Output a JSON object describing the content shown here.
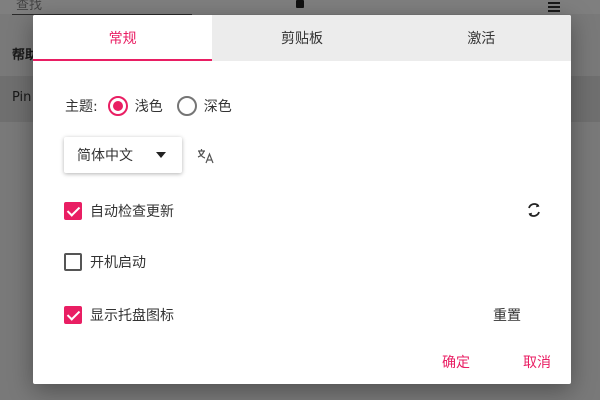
{
  "background": {
    "search_placeholder": "查找",
    "help_label": "帮助",
    "row_text": "Pin"
  },
  "dialog": {
    "tabs": [
      {
        "label": "常规",
        "active": true
      },
      {
        "label": "剪贴板",
        "active": false
      },
      {
        "label": "激活",
        "active": false
      }
    ],
    "theme": {
      "label": "主题:",
      "options": [
        {
          "label": "浅色",
          "checked": true
        },
        {
          "label": "深色",
          "checked": false
        }
      ]
    },
    "language": {
      "selected": "简体中文",
      "icon": "translate-icon"
    },
    "settings": {
      "auto_update": {
        "label": "自动检查更新",
        "checked": true
      },
      "launch_on_boot": {
        "label": "开机启动",
        "checked": false
      },
      "show_tray_icon": {
        "label": "显示托盘图标",
        "checked": true
      }
    },
    "reset_label": "重置",
    "confirm_label": "确定",
    "cancel_label": "取消"
  },
  "colors": {
    "accent": "#e91e63"
  }
}
